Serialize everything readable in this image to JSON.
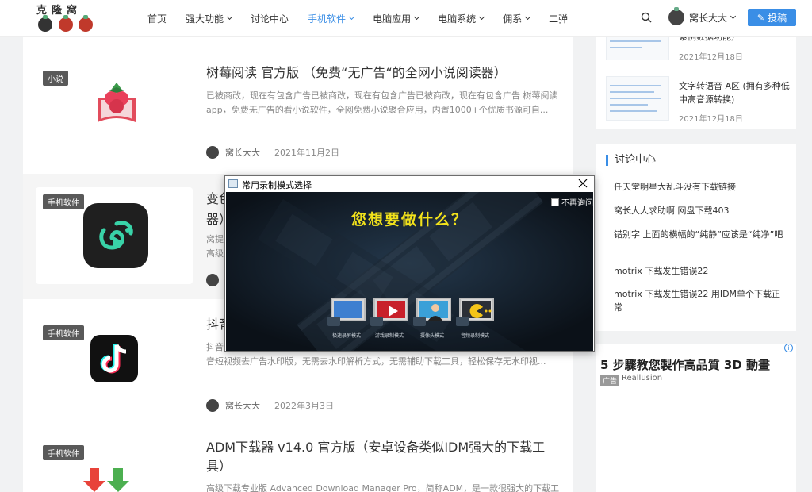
{
  "header": {
    "logo_text": "克隆窝",
    "nav": [
      {
        "label": "首页",
        "has_dropdown": false,
        "active": false
      },
      {
        "label": "强大功能",
        "has_dropdown": true,
        "active": false
      },
      {
        "label": "讨论中心",
        "has_dropdown": false,
        "active": false
      },
      {
        "label": "手机软件",
        "has_dropdown": true,
        "active": true
      },
      {
        "label": "电脑应用",
        "has_dropdown": true,
        "active": false
      },
      {
        "label": "电脑系统",
        "has_dropdown": true,
        "active": false
      },
      {
        "label": "佣系",
        "has_dropdown": true,
        "active": false
      },
      {
        "label": "二弹",
        "has_dropdown": false,
        "active": false
      }
    ],
    "user_name": "窝长大大",
    "post_label": "投稿"
  },
  "articles": [
    {
      "tag": "小说",
      "title": "树莓阅读 官方版 （免费“无广告“的全网小说阅读器）",
      "excerpt": "已被商改，现在有包含广告已被商改，现在有包含广告已被商改，现在有包含广告 树莓阅读app，免费无广告的看小说软件，全网免费小说聚合应用，内置1000+个优质书源可自...",
      "author": "窝长大大",
      "date": "2021年11月2日"
    },
    {
      "tag": "手机软件",
      "title": "变色龙",
      "title_line2": "器）",
      "excerpt": "窝提",
      "excerpt2": "高级",
      "author": "",
      "date": ""
    },
    {
      "tag": "手机软件",
      "title": "抖音",
      "excerpt": "抖音",
      "excerpt2": "音短视频去广告水印版，无需去水印解析方式，无需辅助下载工具，轻松保存无水印视...",
      "author": "窝长大大",
      "date": "2022年3月3日"
    },
    {
      "tag": "手机软件",
      "title": "ADM下载器 v14.0 官方版（安卓设备类似IDM强大的下载工具）",
      "excerpt": "高级下载专业版 Advanced Download Manager Pro，简称ADM，是一款很强大的下载工",
      "author": "",
      "date": ""
    }
  ],
  "sidebar": {
    "recent": [
      {
        "title": "累例数据功能）",
        "date": "2021年12月18日"
      },
      {
        "title": "文字转语音 A区 (拥有多种低中高音源转换)",
        "date": "2021年12月18日"
      }
    ],
    "discuss_title": "讨论中心",
    "discuss_items": [
      "任天堂明星大乱斗没有下载链接",
      "窝长大大求助啊 网盘下载403",
      "错别字 上面的横幅的“纯静”应该是“纯净”吧",
      "motrix 下载发生错误22",
      "motrix 下载发生错误22 用IDM单个下载正常"
    ],
    "ad": {
      "title": "5 步驟教您製作高品質 3D 動畫",
      "badge": "广告",
      "source": "Reallusion",
      "info": "i"
    }
  },
  "dialog": {
    "title": "常用录制模式选择",
    "question": "您想要做什么？",
    "dont_ask_label": "不再询问",
    "modes": [
      {
        "label": "极速录屏模式",
        "icon": "screen-record-icon"
      },
      {
        "label": "游戏录制模式",
        "icon": "game-record-icon"
      },
      {
        "label": "摄像头模式",
        "icon": "camera-record-icon"
      },
      {
        "label": "音频录制模式",
        "icon": "audio-record-icon"
      }
    ]
  },
  "colors": {
    "accent": "#3a8ee6",
    "dialog_bg": "#0d141c",
    "question": "#f2e21b"
  }
}
